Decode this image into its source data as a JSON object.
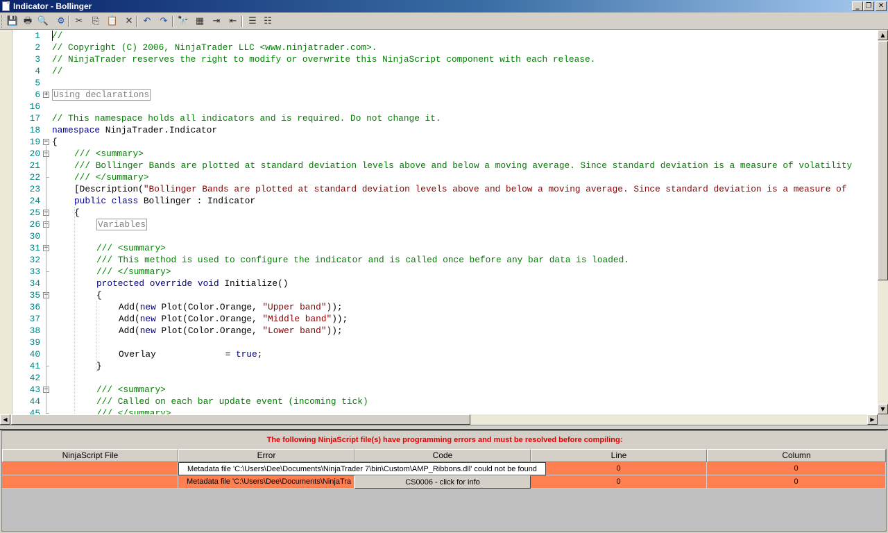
{
  "window": {
    "title": "Indicator - Bollinger",
    "buttons": [
      "minimize",
      "restore",
      "close"
    ]
  },
  "toolbar": {
    "buttons": [
      {
        "name": "save-icon",
        "glyph": "💾"
      },
      {
        "name": "print-icon",
        "glyph": "🖶"
      },
      {
        "name": "print-preview-icon",
        "glyph": "🔍"
      },
      {
        "name": "compile-icon",
        "glyph": "⚙"
      },
      {
        "name": "cut-icon",
        "glyph": "✂"
      },
      {
        "name": "copy-icon",
        "glyph": "⎘"
      },
      {
        "name": "paste-icon",
        "glyph": "📋"
      },
      {
        "name": "delete-icon",
        "glyph": "✕"
      },
      {
        "name": "undo-icon",
        "glyph": "↶"
      },
      {
        "name": "redo-icon",
        "glyph": "↷"
      },
      {
        "name": "find-icon",
        "glyph": "🔭"
      },
      {
        "name": "find-replace-icon",
        "glyph": "▦"
      },
      {
        "name": "indent-icon",
        "glyph": "⇥"
      },
      {
        "name": "outdent-icon",
        "glyph": "⇤"
      },
      {
        "name": "comment-icon",
        "glyph": "☰"
      },
      {
        "name": "uncomment-icon",
        "glyph": "☷"
      }
    ]
  },
  "editor": {
    "lines": [
      {
        "n": "1",
        "fold": "",
        "indent": 0,
        "parts": [
          {
            "c": "c",
            "t": "//"
          }
        ]
      },
      {
        "n": "2",
        "fold": "",
        "indent": 0,
        "parts": [
          {
            "c": "c",
            "t": "// Copyright (C) 2006, NinjaTrader LLC <www.ninjatrader.com>."
          }
        ]
      },
      {
        "n": "3",
        "fold": "",
        "indent": 0,
        "parts": [
          {
            "c": "c",
            "t": "// NinjaTrader reserves the right to modify or overwrite this NinjaScript component with each release."
          }
        ]
      },
      {
        "n": "4",
        "fold": "",
        "indent": 0,
        "parts": [
          {
            "c": "c",
            "t": "//"
          }
        ]
      },
      {
        "n": "5",
        "fold": "",
        "indent": 0,
        "parts": []
      },
      {
        "n": "6",
        "fold": "+",
        "indent": 0,
        "parts": [
          {
            "c": "boxed",
            "t": "Using declarations"
          }
        ]
      },
      {
        "n": "16",
        "fold": "",
        "indent": 0,
        "parts": []
      },
      {
        "n": "17",
        "fold": "",
        "indent": 0,
        "parts": [
          {
            "c": "c",
            "t": "// This namespace holds all indicators and is required. Do not change it."
          }
        ]
      },
      {
        "n": "18",
        "fold": "",
        "indent": 0,
        "parts": [
          {
            "c": "k",
            "t": "namespace"
          },
          {
            "c": "t",
            "t": " NinjaTrader.Indicator"
          }
        ]
      },
      {
        "n": "19",
        "fold": "-",
        "indent": 0,
        "parts": [
          {
            "c": "t",
            "t": "{"
          }
        ]
      },
      {
        "n": "20",
        "fold": "-",
        "indent": 1,
        "parts": [
          {
            "c": "c",
            "t": "/// <summary>"
          }
        ]
      },
      {
        "n": "21",
        "fold": "",
        "indent": 1,
        "parts": [
          {
            "c": "c",
            "t": "/// Bollinger Bands are plotted at standard deviation levels above and below a moving average. Since standard deviation is a measure of volatility"
          }
        ]
      },
      {
        "n": "22",
        "fold": "end",
        "indent": 1,
        "parts": [
          {
            "c": "c",
            "t": "/// </summary>"
          }
        ]
      },
      {
        "n": "23",
        "fold": "",
        "indent": 1,
        "parts": [
          {
            "c": "t",
            "t": "[Description("
          },
          {
            "c": "s",
            "t": "\"Bollinger Bands are plotted at standard deviation levels above and below a moving average. Since standard deviation is a measure of"
          }
        ]
      },
      {
        "n": "24",
        "fold": "",
        "indent": 1,
        "parts": [
          {
            "c": "k",
            "t": "public class"
          },
          {
            "c": "t",
            "t": " Bollinger : Indicator"
          }
        ]
      },
      {
        "n": "25",
        "fold": "-",
        "indent": 1,
        "parts": [
          {
            "c": "t",
            "t": "{"
          }
        ]
      },
      {
        "n": "26",
        "fold": "+",
        "indent": 2,
        "parts": [
          {
            "c": "boxed",
            "t": "Variables"
          }
        ]
      },
      {
        "n": "30",
        "fold": "",
        "indent": 2,
        "parts": []
      },
      {
        "n": "31",
        "fold": "-",
        "indent": 2,
        "parts": [
          {
            "c": "c",
            "t": "/// <summary>"
          }
        ]
      },
      {
        "n": "32",
        "fold": "",
        "indent": 2,
        "parts": [
          {
            "c": "c",
            "t": "/// This method is used to configure the indicator and is called once before any bar data is loaded."
          }
        ]
      },
      {
        "n": "33",
        "fold": "end",
        "indent": 2,
        "parts": [
          {
            "c": "c",
            "t": "/// </summary>"
          }
        ]
      },
      {
        "n": "34",
        "fold": "",
        "indent": 2,
        "parts": [
          {
            "c": "k",
            "t": "protected override void"
          },
          {
            "c": "t",
            "t": " Initialize()"
          }
        ]
      },
      {
        "n": "35",
        "fold": "-",
        "indent": 2,
        "parts": [
          {
            "c": "t",
            "t": "{"
          }
        ]
      },
      {
        "n": "36",
        "fold": "",
        "indent": 3,
        "parts": [
          {
            "c": "t",
            "t": "Add("
          },
          {
            "c": "k",
            "t": "new"
          },
          {
            "c": "t",
            "t": " Plot(Color.Orange, "
          },
          {
            "c": "s",
            "t": "\"Upper band\""
          },
          {
            "c": "t",
            "t": "));"
          }
        ]
      },
      {
        "n": "37",
        "fold": "",
        "indent": 3,
        "parts": [
          {
            "c": "t",
            "t": "Add("
          },
          {
            "c": "k",
            "t": "new"
          },
          {
            "c": "t",
            "t": " Plot(Color.Orange, "
          },
          {
            "c": "s",
            "t": "\"Middle band\""
          },
          {
            "c": "t",
            "t": "));"
          }
        ]
      },
      {
        "n": "38",
        "fold": "",
        "indent": 3,
        "parts": [
          {
            "c": "t",
            "t": "Add("
          },
          {
            "c": "k",
            "t": "new"
          },
          {
            "c": "t",
            "t": " Plot(Color.Orange, "
          },
          {
            "c": "s",
            "t": "\"Lower band\""
          },
          {
            "c": "t",
            "t": "));"
          }
        ]
      },
      {
        "n": "39",
        "fold": "",
        "indent": 3,
        "parts": []
      },
      {
        "n": "40",
        "fold": "",
        "indent": 3,
        "parts": [
          {
            "c": "t",
            "t": "Overlay             = "
          },
          {
            "c": "k",
            "t": "true"
          },
          {
            "c": "t",
            "t": ";"
          }
        ]
      },
      {
        "n": "41",
        "fold": "end",
        "indent": 2,
        "parts": [
          {
            "c": "t",
            "t": "}"
          }
        ]
      },
      {
        "n": "42",
        "fold": "",
        "indent": 2,
        "parts": []
      },
      {
        "n": "43",
        "fold": "-",
        "indent": 2,
        "parts": [
          {
            "c": "c",
            "t": "/// <summary>"
          }
        ]
      },
      {
        "n": "44",
        "fold": "",
        "indent": 2,
        "parts": [
          {
            "c": "c",
            "t": "/// Called on each bar update event (incoming tick)"
          }
        ]
      },
      {
        "n": "45",
        "fold": "end",
        "indent": 2,
        "parts": [
          {
            "c": "c",
            "t": "/// </summary>"
          }
        ]
      }
    ]
  },
  "errors": {
    "message": "The following NinjaScript file(s) have programming errors and must be resolved before compiling:",
    "columns": [
      "NinjaScript File",
      "Error",
      "Code",
      "Line",
      "Column"
    ],
    "rows": [
      {
        "file": "",
        "error": "Metadata file 'C:\\Users\\Dee\\Documents\\NinjaTrader 7\\bin\\Custom\\AMP_Ribbons.dll' could not be found",
        "code": "",
        "line": "0",
        "column": "0"
      },
      {
        "file": "",
        "error": "Metadata file 'C:\\Users\\Dee\\Documents\\NinjaTra",
        "code": "CS0006 - click for info",
        "line": "0",
        "column": "0"
      }
    ]
  },
  "colors": {
    "error_row": "#ff7f50",
    "error_text": "#e00000",
    "comment": "#008000",
    "keyword": "#00008b",
    "string": "#8b0000",
    "line_number": "#008080"
  }
}
